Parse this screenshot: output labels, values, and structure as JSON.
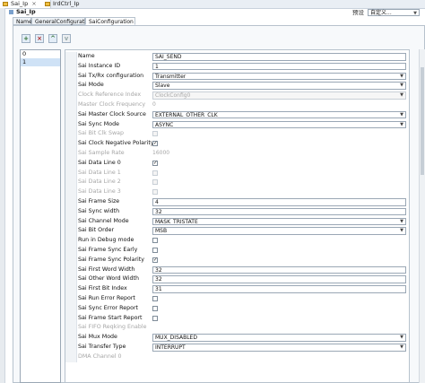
{
  "window": {
    "tabs": [
      {
        "label": "Sai_Ip",
        "active": true
      },
      {
        "label": "IrdCtrl_Ip",
        "active": false
      }
    ],
    "close_glyph": "×",
    "preset_label": "预设",
    "preset_value": "自定义..."
  },
  "component": {
    "name": "Sai_Ip"
  },
  "subtabs": [
    "Name",
    "GeneralConfiguration",
    "SaiConfiguration"
  ],
  "toolbar": {
    "add": "+",
    "remove": "×",
    "up": "^",
    "down": "v"
  },
  "list": {
    "items": [
      "0",
      "1"
    ],
    "selected_index": 1
  },
  "properties": [
    {
      "label": "Name",
      "type": "text",
      "value": "SAI_SEND",
      "enabled": true
    },
    {
      "label": "Sai Instance ID",
      "type": "text",
      "value": "1",
      "enabled": true
    },
    {
      "label": "Sai Tx/Rx configuration",
      "type": "combo",
      "value": "Transmitter",
      "enabled": true
    },
    {
      "label": "Sai Mode",
      "type": "combo",
      "value": "Slave",
      "enabled": true
    },
    {
      "label": "Clock Reference Index",
      "type": "combo",
      "value": "ClockConfig0",
      "enabled": false
    },
    {
      "label": "Master Clock Frequency",
      "type": "plain",
      "value": "0",
      "enabled": false
    },
    {
      "label": "Sai Master Clock Source",
      "type": "combo",
      "value": "EXTERNAL_OTHER_CLK",
      "enabled": true
    },
    {
      "label": "Sai Sync Mode",
      "type": "combo",
      "value": "ASYNC",
      "enabled": true
    },
    {
      "label": "Sai Bit Clk Swap",
      "type": "check",
      "checked": false,
      "enabled": false
    },
    {
      "label": "Sai Clock Negative Polarity",
      "type": "check",
      "checked": true,
      "enabled": true
    },
    {
      "label": "Sai Sample Rate",
      "type": "plain",
      "value": "16000",
      "enabled": false
    },
    {
      "label": "Sai Data Line 0",
      "type": "check",
      "checked": true,
      "enabled": true
    },
    {
      "label": "Sai Data Line 1",
      "type": "check",
      "checked": false,
      "enabled": false
    },
    {
      "label": "Sai Data Line 2",
      "type": "check",
      "checked": false,
      "enabled": false
    },
    {
      "label": "Sai Data Line 3",
      "type": "check",
      "checked": false,
      "enabled": false
    },
    {
      "label": "Sai Frame Size",
      "type": "text",
      "value": "4",
      "enabled": true
    },
    {
      "label": "Sai Sync width",
      "type": "text",
      "value": "32",
      "enabled": true
    },
    {
      "label": "Sai Channel Mode",
      "type": "combo",
      "value": "MASK_TRISTATE",
      "enabled": true
    },
    {
      "label": "Sai Bit Order",
      "type": "combo",
      "value": "MSB",
      "enabled": true
    },
    {
      "label": "Run in Debug mode",
      "type": "check",
      "checked": false,
      "enabled": true
    },
    {
      "label": "Sai Frame Sync Early",
      "type": "check",
      "checked": false,
      "enabled": true
    },
    {
      "label": "Sai Frame Sync Polarity",
      "type": "check",
      "checked": true,
      "enabled": true
    },
    {
      "label": "Sai First Word Width",
      "type": "text",
      "value": "32",
      "enabled": true
    },
    {
      "label": "Sai Other Word Width",
      "type": "text",
      "value": "32",
      "enabled": true
    },
    {
      "label": "Sai First Bit Index",
      "type": "text",
      "value": "31",
      "enabled": true
    },
    {
      "label": "Sai Run Error Report",
      "type": "check",
      "checked": false,
      "enabled": true
    },
    {
      "label": "Sai Sync Error Report",
      "type": "check",
      "checked": false,
      "enabled": true
    },
    {
      "label": "Sai Frame Start Report",
      "type": "check",
      "checked": false,
      "enabled": true
    },
    {
      "label": "Sai FIFO Reqking Enable",
      "type": "none",
      "enabled": false
    },
    {
      "label": "Sai Mux Mode",
      "type": "combo",
      "value": "MUX_DISABLED",
      "enabled": true
    },
    {
      "label": "Sai Transfer Type",
      "type": "combo",
      "value": "INTERRUPT",
      "enabled": true
    },
    {
      "label": "DMA Channel 0",
      "type": "none",
      "enabled": false
    }
  ]
}
